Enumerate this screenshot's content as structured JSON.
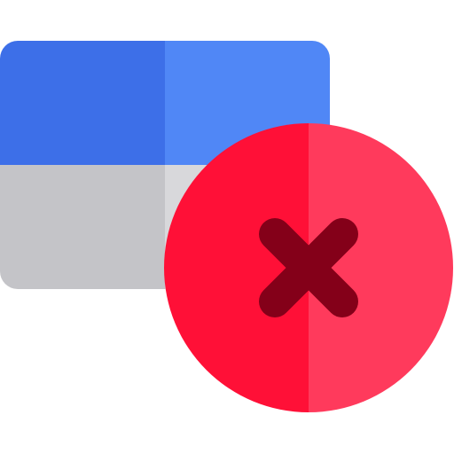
{
  "icon": {
    "name": "window-error-icon",
    "colors": {
      "window_header_dark": "#3D6FE8",
      "window_header_light": "#5087F6",
      "window_body_dark": "#C4C4C8",
      "window_body_light": "#D8D8DB",
      "circle_dark": "#FF1037",
      "circle_light": "#FF3A5C",
      "cross": "#840019"
    }
  }
}
